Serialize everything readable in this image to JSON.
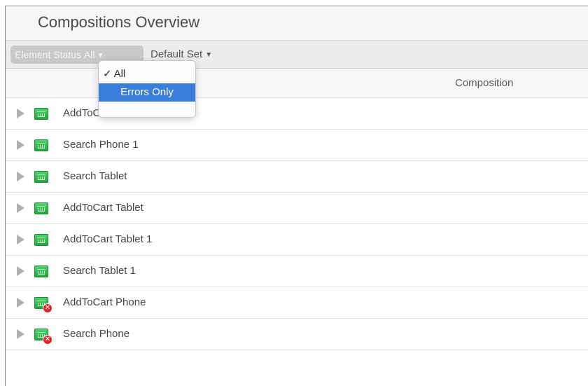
{
  "header": {
    "title": "Compositions Overview"
  },
  "toolbar": {
    "status_label": "Element Status",
    "status_value": "All",
    "status_arrow": "▼",
    "set_label": "Default Set",
    "set_arrow": "▼"
  },
  "dropdown": {
    "options": [
      {
        "label": "All",
        "checked": true,
        "check_mark": "✓"
      },
      {
        "label": "Errors Only",
        "highlighted": true
      }
    ]
  },
  "table": {
    "column_header": "Composition",
    "rows": [
      {
        "name": "AddToCart Phone 1",
        "status": "ok"
      },
      {
        "name": "Search Phone 1",
        "status": "ok"
      },
      {
        "name": "Search Tablet",
        "status": "ok"
      },
      {
        "name": "AddToCart Tablet",
        "status": "ok"
      },
      {
        "name": "AddToCart Tablet 1",
        "status": "ok"
      },
      {
        "name": "Search Tablet 1",
        "status": "ok"
      },
      {
        "name": "AddToCart Phone",
        "status": "error"
      },
      {
        "name": "Search Phone",
        "status": "error"
      }
    ]
  },
  "icons": {
    "disclosure": "disclosure-triangle-icon",
    "app": "app-status-icon",
    "error": "error-badge-icon",
    "error_glyph": "✕"
  },
  "colors": {
    "ok_green": "#2cbd4a",
    "error_red": "#e0262c",
    "selection_blue": "#3a7ddb"
  }
}
